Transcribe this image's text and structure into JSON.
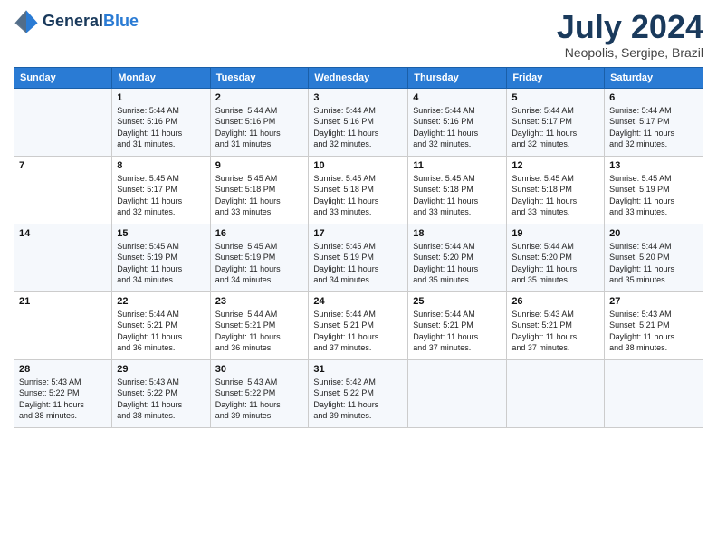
{
  "header": {
    "logo_general": "General",
    "logo_blue": "Blue",
    "month": "July 2024",
    "location": "Neopolis, Sergipe, Brazil"
  },
  "columns": [
    "Sunday",
    "Monday",
    "Tuesday",
    "Wednesday",
    "Thursday",
    "Friday",
    "Saturday"
  ],
  "weeks": [
    [
      {
        "day": "",
        "info": ""
      },
      {
        "day": "1",
        "info": "Sunrise: 5:44 AM\nSunset: 5:16 PM\nDaylight: 11 hours\nand 31 minutes."
      },
      {
        "day": "2",
        "info": "Sunrise: 5:44 AM\nSunset: 5:16 PM\nDaylight: 11 hours\nand 31 minutes."
      },
      {
        "day": "3",
        "info": "Sunrise: 5:44 AM\nSunset: 5:16 PM\nDaylight: 11 hours\nand 32 minutes."
      },
      {
        "day": "4",
        "info": "Sunrise: 5:44 AM\nSunset: 5:16 PM\nDaylight: 11 hours\nand 32 minutes."
      },
      {
        "day": "5",
        "info": "Sunrise: 5:44 AM\nSunset: 5:17 PM\nDaylight: 11 hours\nand 32 minutes."
      },
      {
        "day": "6",
        "info": "Sunrise: 5:44 AM\nSunset: 5:17 PM\nDaylight: 11 hours\nand 32 minutes."
      }
    ],
    [
      {
        "day": "7",
        "info": ""
      },
      {
        "day": "8",
        "info": "Sunrise: 5:45 AM\nSunset: 5:17 PM\nDaylight: 11 hours\nand 32 minutes."
      },
      {
        "day": "9",
        "info": "Sunrise: 5:45 AM\nSunset: 5:18 PM\nDaylight: 11 hours\nand 33 minutes."
      },
      {
        "day": "10",
        "info": "Sunrise: 5:45 AM\nSunset: 5:18 PM\nDaylight: 11 hours\nand 33 minutes."
      },
      {
        "day": "11",
        "info": "Sunrise: 5:45 AM\nSunset: 5:18 PM\nDaylight: 11 hours\nand 33 minutes."
      },
      {
        "day": "12",
        "info": "Sunrise: 5:45 AM\nSunset: 5:18 PM\nDaylight: 11 hours\nand 33 minutes."
      },
      {
        "day": "13",
        "info": "Sunrise: 5:45 AM\nSunset: 5:19 PM\nDaylight: 11 hours\nand 33 minutes."
      }
    ],
    [
      {
        "day": "14",
        "info": ""
      },
      {
        "day": "15",
        "info": "Sunrise: 5:45 AM\nSunset: 5:19 PM\nDaylight: 11 hours\nand 34 minutes."
      },
      {
        "day": "16",
        "info": "Sunrise: 5:45 AM\nSunset: 5:19 PM\nDaylight: 11 hours\nand 34 minutes."
      },
      {
        "day": "17",
        "info": "Sunrise: 5:45 AM\nSunset: 5:19 PM\nDaylight: 11 hours\nand 34 minutes."
      },
      {
        "day": "18",
        "info": "Sunrise: 5:44 AM\nSunset: 5:20 PM\nDaylight: 11 hours\nand 35 minutes."
      },
      {
        "day": "19",
        "info": "Sunrise: 5:44 AM\nSunset: 5:20 PM\nDaylight: 11 hours\nand 35 minutes."
      },
      {
        "day": "20",
        "info": "Sunrise: 5:44 AM\nSunset: 5:20 PM\nDaylight: 11 hours\nand 35 minutes."
      }
    ],
    [
      {
        "day": "21",
        "info": ""
      },
      {
        "day": "22",
        "info": "Sunrise: 5:44 AM\nSunset: 5:21 PM\nDaylight: 11 hours\nand 36 minutes."
      },
      {
        "day": "23",
        "info": "Sunrise: 5:44 AM\nSunset: 5:21 PM\nDaylight: 11 hours\nand 36 minutes."
      },
      {
        "day": "24",
        "info": "Sunrise: 5:44 AM\nSunset: 5:21 PM\nDaylight: 11 hours\nand 37 minutes."
      },
      {
        "day": "25",
        "info": "Sunrise: 5:44 AM\nSunset: 5:21 PM\nDaylight: 11 hours\nand 37 minutes."
      },
      {
        "day": "26",
        "info": "Sunrise: 5:43 AM\nSunset: 5:21 PM\nDaylight: 11 hours\nand 37 minutes."
      },
      {
        "day": "27",
        "info": "Sunrise: 5:43 AM\nSunset: 5:21 PM\nDaylight: 11 hours\nand 38 minutes."
      }
    ],
    [
      {
        "day": "28",
        "info": "Sunrise: 5:43 AM\nSunset: 5:22 PM\nDaylight: 11 hours\nand 38 minutes."
      },
      {
        "day": "29",
        "info": "Sunrise: 5:43 AM\nSunset: 5:22 PM\nDaylight: 11 hours\nand 38 minutes."
      },
      {
        "day": "30",
        "info": "Sunrise: 5:43 AM\nSunset: 5:22 PM\nDaylight: 11 hours\nand 39 minutes."
      },
      {
        "day": "31",
        "info": "Sunrise: 5:42 AM\nSunset: 5:22 PM\nDaylight: 11 hours\nand 39 minutes."
      },
      {
        "day": "",
        "info": ""
      },
      {
        "day": "",
        "info": ""
      },
      {
        "day": "",
        "info": ""
      }
    ]
  ]
}
